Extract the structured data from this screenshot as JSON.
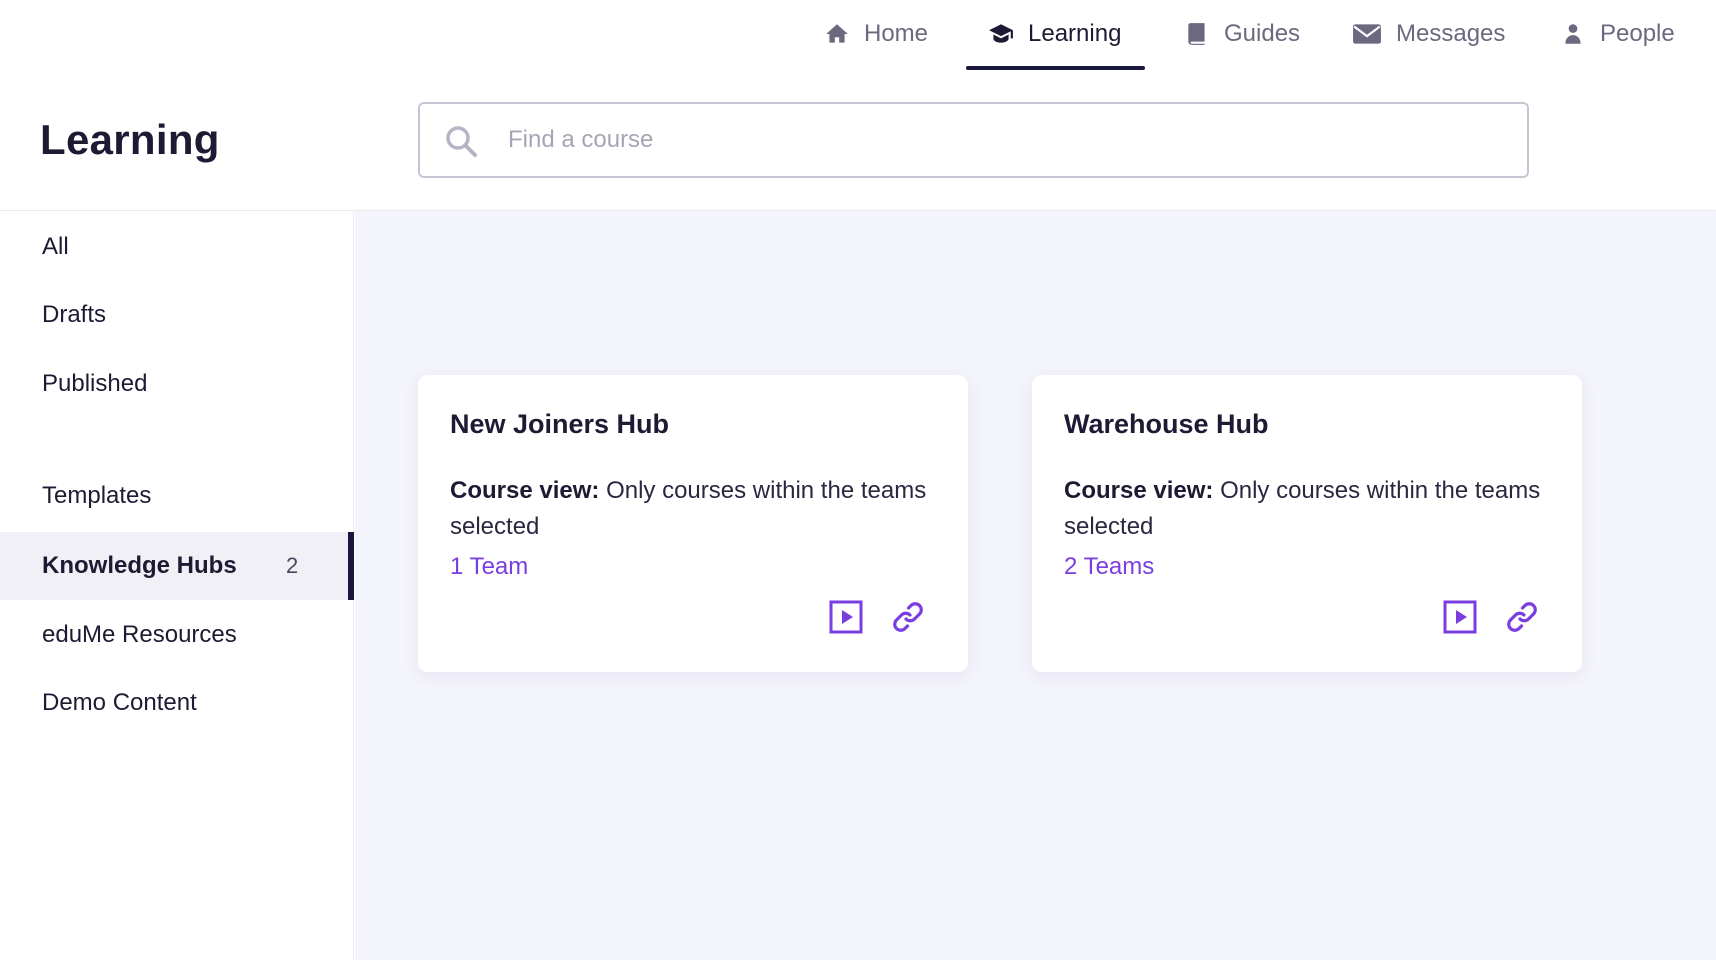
{
  "nav": {
    "items": [
      {
        "label": "Home",
        "icon": "home-icon",
        "active": false
      },
      {
        "label": "Learning",
        "icon": "graduation-cap-icon",
        "active": true
      },
      {
        "label": "Guides",
        "icon": "book-icon",
        "active": false
      },
      {
        "label": "Messages",
        "icon": "envelope-icon",
        "active": false
      },
      {
        "label": "People",
        "icon": "person-icon",
        "active": false
      }
    ]
  },
  "page": {
    "title": "Learning"
  },
  "search": {
    "placeholder": "Find a course",
    "value": ""
  },
  "sidebar": {
    "items": [
      {
        "label": "All"
      },
      {
        "label": "Drafts"
      },
      {
        "label": "Published"
      },
      {
        "label": "Templates"
      },
      {
        "label": "Knowledge Hubs",
        "count": "2",
        "active": true
      },
      {
        "label": "eduMe Resources"
      },
      {
        "label": "Demo Content"
      }
    ]
  },
  "hubs": [
    {
      "title": "New Joiners Hub",
      "view_label": "Course view:",
      "view_text": "Only courses within the teams selected",
      "teams": "1 Team"
    },
    {
      "title": "Warehouse Hub",
      "view_label": "Course view:",
      "view_text": "Only courses within the teams selected",
      "teams": "2 Teams"
    }
  ],
  "colors": {
    "accent": "#7a3ee0",
    "nav_active": "#1b1840",
    "main_bg": "#f4f4fc"
  }
}
